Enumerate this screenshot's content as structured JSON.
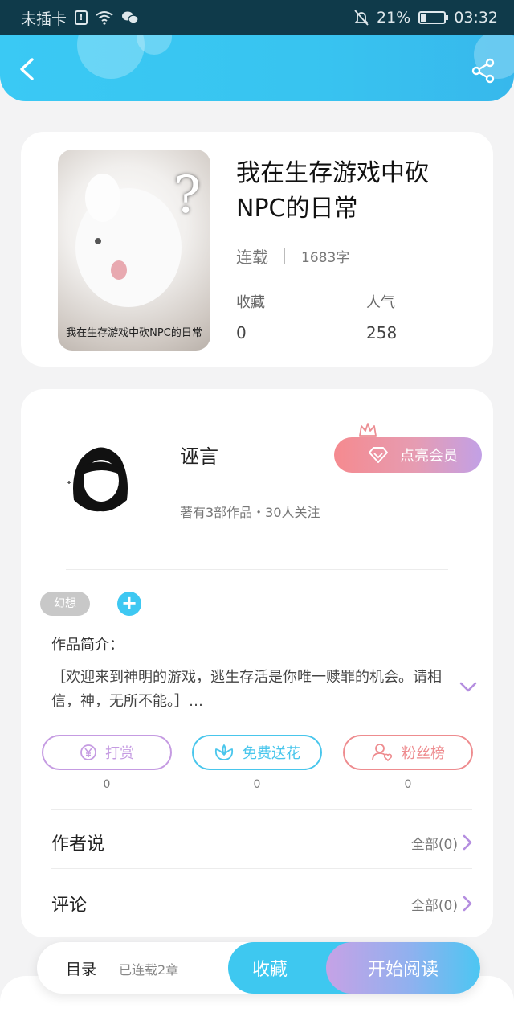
{
  "status_bar": {
    "carrier": "未插卡",
    "alert_glyph": "!",
    "battery_percent": "21%",
    "battery_level": 0.21,
    "time": "03:32"
  },
  "header": {
    "back_icon": "chevron-left-icon",
    "share_icon": "share-icon"
  },
  "book": {
    "title": "我在生存游戏中砍NPC的日常",
    "cover_caption": "我在生存游戏中砍NPC的日常",
    "status": "连载",
    "word_count": "1683字",
    "favorites_label": "收藏",
    "favorites_value": "0",
    "popularity_label": "人气",
    "popularity_value": "258"
  },
  "author": {
    "name": "诬言",
    "meta": "著有3部作品・30人关注",
    "vip_label": "点亮会员"
  },
  "tags": {
    "items": [
      "幻想"
    ],
    "add_label": "+"
  },
  "intro": {
    "label": "作品简介：",
    "text": "［欢迎来到神明的游戏，逃生存活是你唯一赎罪的机会。请相信，神，无所不能。］…"
  },
  "actions": [
    {
      "label": "打赏",
      "count": "0",
      "icon": "yen-icon",
      "color": "#c59be2"
    },
    {
      "label": "免费送花",
      "count": "0",
      "icon": "flower-icon",
      "color": "#49c6ec"
    },
    {
      "label": "粉丝榜",
      "count": "0",
      "icon": "fan-icon",
      "color": "#ee8c8f"
    }
  ],
  "sections": [
    {
      "title": "作者说",
      "more": "全部(0)"
    },
    {
      "title": "评论",
      "more": "全部(0)"
    }
  ],
  "bottom_bar": {
    "toc_label": "目录",
    "chapters_label": "已连载2章",
    "favorite_label": "收藏",
    "read_label": "开始阅读"
  }
}
